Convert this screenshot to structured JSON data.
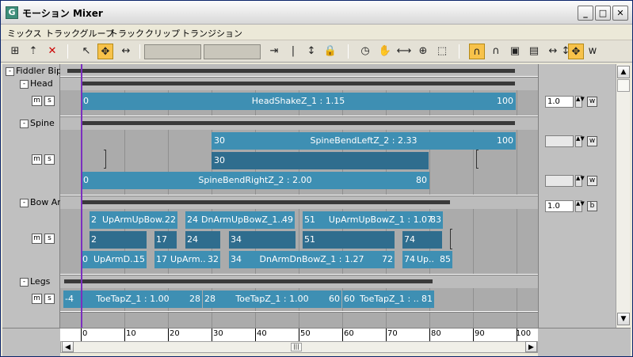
{
  "window": {
    "title": "モーション Mixer",
    "icon": "app-icon"
  },
  "menu": [
    "ミックス",
    "トラックグループ",
    "トラック",
    "クリップ",
    "トランジション"
  ],
  "toolbar": {
    "icons": [
      "add-track-icon",
      "add-transition-icon",
      "delete-icon",
      "select-icon",
      "move-icon",
      "slip-icon",
      "frame-icon",
      "bar-icon",
      "trim-icon",
      "lock-icon",
      "clock-icon",
      "hand-icon",
      "range-icon",
      "zoom-icon",
      "zoom-region-icon",
      "snap-icon",
      "snap2-icon",
      "show-curve-icon",
      "show-balance-icon",
      "arrows-h-icon",
      "arrows-v-icon",
      "move-all-icon"
    ],
    "w_label": "w"
  },
  "groups": {
    "root": {
      "label": "Fiddler Bipe",
      "collapse": "-"
    },
    "head": {
      "label": "Head",
      "collapse": "-",
      "m": "m",
      "s": "s"
    },
    "spine": {
      "label": "Spine",
      "collapse": "-",
      "m": "m",
      "s": "s"
    },
    "bowarm": {
      "label": "Bow Arr",
      "collapse": "-",
      "m": "m",
      "s": "s"
    },
    "legs": {
      "label": "Legs",
      "collapse": "-",
      "m": "m",
      "s": "s"
    }
  },
  "clips": {
    "head1": {
      "start": "0",
      "name": "HeadShakeZ_1 : 1.15",
      "end": "100"
    },
    "spine1": {
      "start": "30",
      "name": "SpineBendLeftZ_2 : 2.33",
      "end": "100"
    },
    "spine2": {
      "start": "30"
    },
    "spine3": {
      "start": "0",
      "name": "SpineBendRightZ_2 : 2.00",
      "end": "80"
    },
    "arm1": {
      "start": "2",
      "name": "UpArmUpBow..",
      "end": "22"
    },
    "arm2": {
      "start": "24",
      "name": "DnArmUpBowZ_1..",
      "end": "49"
    },
    "arm3": {
      "start": "51",
      "name": "UpArmUpBowZ_1 : 1.07",
      "end": "83"
    },
    "arm4": {
      "start": "2"
    },
    "arm5": {
      "start": "17"
    },
    "arm6": {
      "start": "24"
    },
    "arm7": {
      "start": "34"
    },
    "arm8": {
      "start": "51"
    },
    "arm9": {
      "start": "74"
    },
    "arm10": {
      "start": "0",
      "name": "UpArmD..",
      "end": "15"
    },
    "arm11": {
      "start": "17",
      "name": "UpArm..",
      "end": "32"
    },
    "arm12": {
      "start": "34",
      "name": "DnArmDnBowZ_1 : 1.27",
      "end": "72"
    },
    "arm13": {
      "start": "74",
      "name": "Up..",
      "end": "85"
    },
    "leg1": {
      "start": "-4",
      "name": "ToeTapZ_1 : 1.00",
      "end": "28"
    },
    "leg2": {
      "start": "28",
      "name": "ToeTapZ_1 : 1.00",
      "end": "60"
    },
    "leg3": {
      "start": "60",
      "name": "ToeTapZ_1 : ..",
      "end": "81"
    }
  },
  "weights": {
    "head": {
      "value": "1.0",
      "btn": "w"
    },
    "spine1": {
      "value": "",
      "btn": "w"
    },
    "spine2": {
      "value": "",
      "btn": "w"
    },
    "bowarm": {
      "value": "1.0",
      "btn": "b"
    }
  },
  "ruler": {
    "labels": [
      "0",
      "10",
      "20",
      "30",
      "40",
      "50",
      "60",
      "70",
      "80",
      "90",
      "100"
    ]
  }
}
